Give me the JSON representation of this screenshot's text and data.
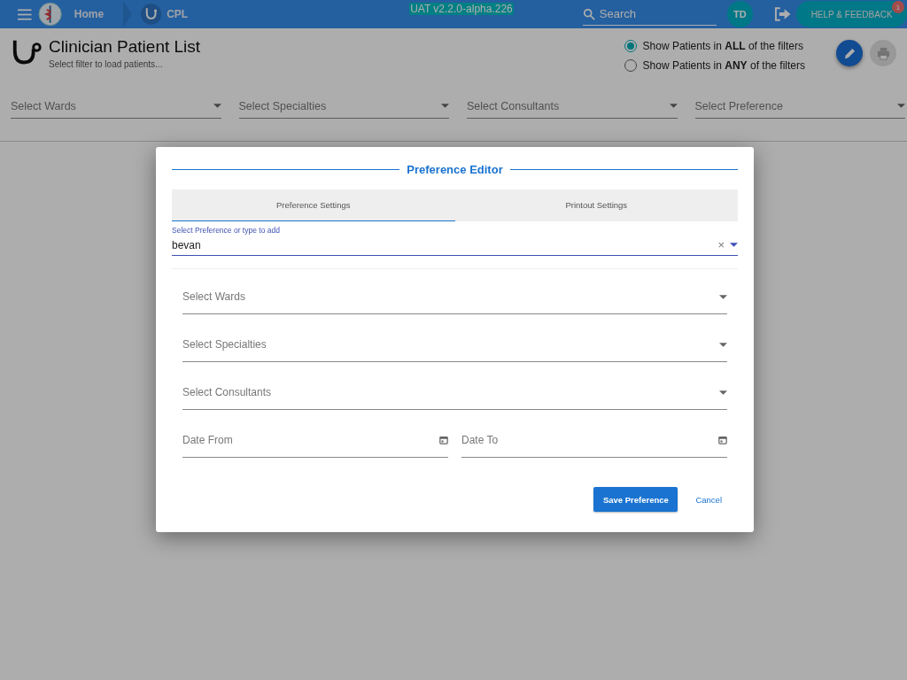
{
  "app_bar": {
    "breadcrumbs": [
      {
        "label": "Home"
      },
      {
        "label": "CPL"
      }
    ],
    "version": "UAT v2.2.0-alpha.226",
    "search": {
      "placeholder": "Search"
    },
    "avatar": "TD",
    "help_button": "HELP & FEEDBACK",
    "notification_count": "1"
  },
  "page": {
    "title": "Clinician Patient List",
    "subtitle": "Select filter to load patients...",
    "filter_mode": [
      {
        "label": "Show Patients in **ALL** of the filters",
        "selected": true
      },
      {
        "label": "Show Patients in **ANY** of the filters",
        "selected": false
      }
    ],
    "filters": [
      {
        "placeholder": "Select Wards"
      },
      {
        "placeholder": "Select Specialties"
      },
      {
        "placeholder": "Select Consultants"
      },
      {
        "placeholder": "Select Preference"
      }
    ]
  },
  "dialog": {
    "title": "Preference Editor",
    "tabs": [
      {
        "label": "Preference Settings",
        "selected": true
      },
      {
        "label": "Printout Settings",
        "selected": false
      }
    ],
    "preference_field": {
      "label": "Select Preference or type to add",
      "value": "bevan",
      "clear": "×"
    },
    "selects": [
      {
        "placeholder": "Select Wards"
      },
      {
        "placeholder": "Select Specialties"
      },
      {
        "placeholder": "Select Consultants"
      }
    ],
    "dates": [
      {
        "placeholder": "Date From"
      },
      {
        "placeholder": "Date To"
      }
    ],
    "save_button": "Save Preference",
    "cancel_button": "Cancel"
  }
}
